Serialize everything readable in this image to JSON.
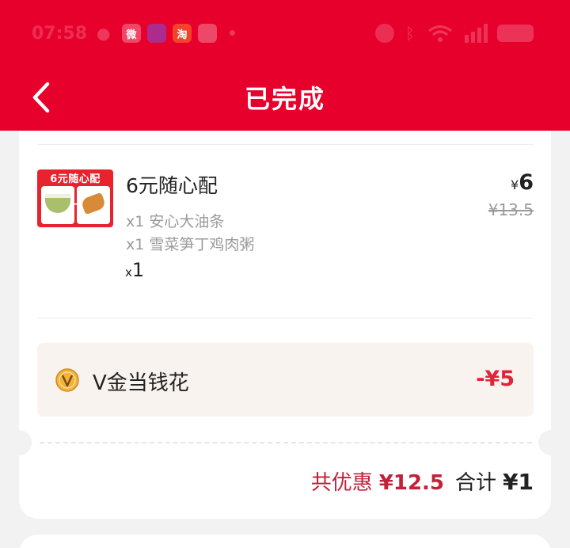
{
  "status_bar": {
    "time": "07:58",
    "icons": [
      "wechat-icon",
      "weibo-icon",
      "app-icon",
      "taobao-icon",
      "app-icon",
      "dot-icon",
      "alarm-icon",
      "bluetooth-icon",
      "wifi-icon",
      "signal-icon",
      "battery-icon"
    ],
    "app_badges": {
      "weibo": "微",
      "taobao": "淘"
    }
  },
  "header": {
    "title": "已完成",
    "back_icon": "chevron-left-icon",
    "background_color": "#e8002d"
  },
  "order_item": {
    "image_text": "6元随心配",
    "image_plus": "+",
    "name": "6元随心配",
    "sub_items": [
      "x1 安心大油条",
      "x1 雪菜笋丁鸡肉粥"
    ],
    "quantity_prefix": "x",
    "quantity": "1",
    "price_symbol": "¥",
    "price": "6",
    "original_price": "¥13.5"
  },
  "coupon": {
    "icon": "v-gold-coin-icon",
    "label": "V金当钱花",
    "amount": "-¥5",
    "amount_color": "#e0243a"
  },
  "summary": {
    "discount_label": "共优惠",
    "discount_value": "¥12.5",
    "total_label": "合计",
    "total_value": "¥1",
    "discount_color": "#c3203a"
  }
}
